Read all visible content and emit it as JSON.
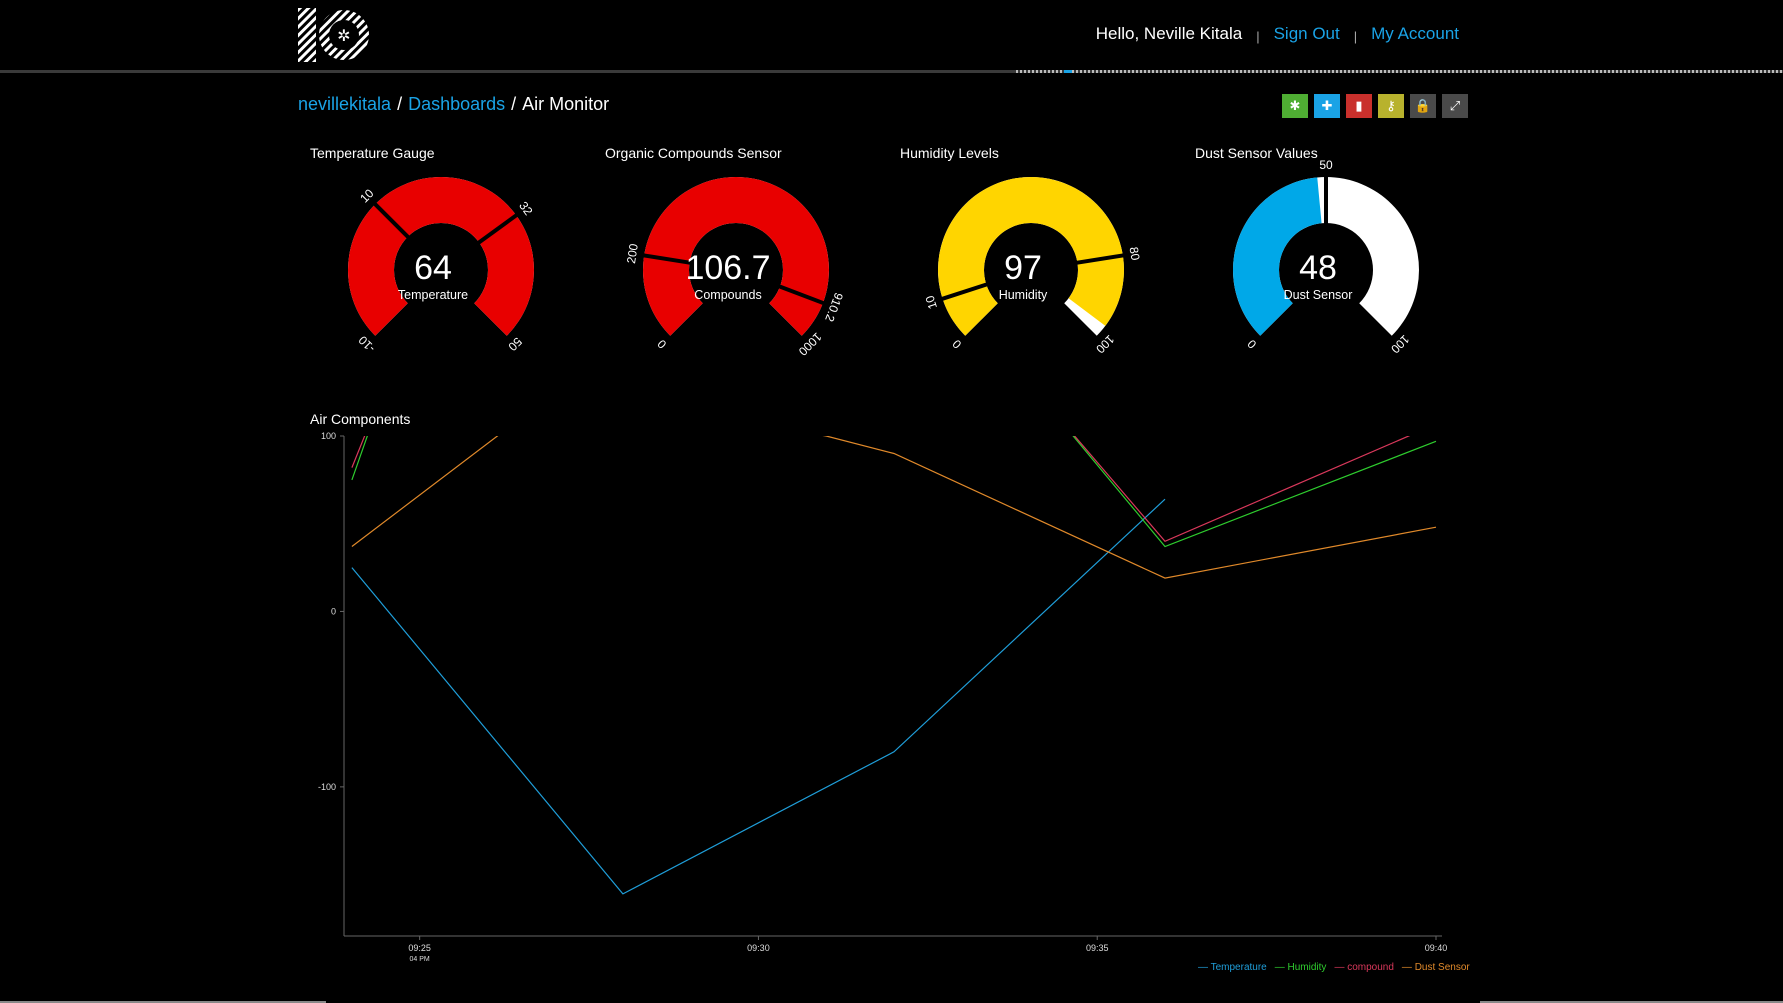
{
  "header": {
    "greeting": "Hello, Neville Kitala",
    "separator": "|",
    "sign_out": "Sign Out",
    "my_account": "My Account"
  },
  "breadcrumb": {
    "user": "nevillekitala",
    "slash": "/",
    "dashboards": "Dashboards",
    "current": "Air Monitor"
  },
  "toolbar": [
    {
      "name": "settings-button",
      "icon": "gear-icon",
      "glyph": "✱",
      "color": "#4fae33"
    },
    {
      "name": "add-block-button",
      "icon": "plus-icon",
      "glyph": "✚",
      "color": "#1aa3e6"
    },
    {
      "name": "delete-button",
      "icon": "trash-icon",
      "glyph": "▮",
      "color": "#c9302c"
    },
    {
      "name": "key-button",
      "icon": "key-icon",
      "glyph": "⚷",
      "color": "#b8b22d"
    },
    {
      "name": "lock-button",
      "icon": "lock-icon",
      "glyph": "🔒",
      "color": "#4a4a4a"
    },
    {
      "name": "fullscreen-button",
      "icon": "expand-icon",
      "glyph": "⤢",
      "color": "#4a4a4a"
    }
  ],
  "gauges": [
    {
      "title": "Temperature Gauge",
      "value": "64",
      "label": "Temperature",
      "min": -10,
      "max": 50,
      "current": 64,
      "min_label": "-10",
      "max_label": "50",
      "fill_color": "#e80000",
      "rest_color": "#ffffff",
      "thresholds": [
        {
          "value": 10,
          "label": "10"
        },
        {
          "value": 32,
          "label": "32"
        }
      ]
    },
    {
      "title": "Organic Compounds Sensor",
      "value": "106.7",
      "label": "Compounds",
      "min": 0,
      "max": 1000,
      "current": 1000,
      "min_label": "0",
      "max_label": "1000",
      "fill_color": "#e80000",
      "rest_color": "#ffffff",
      "thresholds": [
        {
          "value": 200,
          "label": "200"
        },
        {
          "value": 910.2,
          "label": "910.2"
        }
      ]
    },
    {
      "title": "Humidity Levels",
      "value": "97",
      "label": "Humidity",
      "min": 0,
      "max": 100,
      "current": 97,
      "min_label": "0",
      "max_label": "100",
      "fill_color": "#ffd500",
      "rest_color": "#ffffff",
      "thresholds": [
        {
          "value": 10,
          "label": "10"
        },
        {
          "value": 80,
          "label": "80"
        }
      ]
    },
    {
      "title": "Dust Sensor Values",
      "value": "48",
      "label": "Dust Sensor",
      "min": 0,
      "max": 100,
      "current": 48,
      "min_label": "0",
      "max_label": "100",
      "fill_color": "#00a8e8",
      "rest_color": "#ffffff",
      "thresholds": [
        {
          "value": 50,
          "label": "50"
        }
      ]
    }
  ],
  "chart_title": "Air Components",
  "chart_data": {
    "type": "line",
    "ylim": [
      -185,
      100
    ],
    "yticks": [
      {
        "value": 100,
        "label": "100"
      },
      {
        "value": 0,
        "label": "0"
      },
      {
        "value": -100,
        "label": "-100"
      }
    ],
    "xlim": [
      "09:23:53",
      "09:40"
    ],
    "xticks": [
      {
        "time": "09:25",
        "label": "09:25",
        "sublabel": "04 PM"
      },
      {
        "time": "09:30",
        "label": "09:30",
        "sublabel": ""
      },
      {
        "time": "09:35",
        "label": "09:35",
        "sublabel": ""
      },
      {
        "time": "09:40",
        "label": "09:40",
        "sublabel": ""
      }
    ],
    "series": [
      {
        "name": "Temperature",
        "color": "#1f9ed9",
        "points": [
          [
            "09:24",
            25
          ],
          [
            "09:28",
            -161
          ],
          [
            "09:32",
            -80
          ],
          [
            "09:36",
            64
          ]
        ]
      },
      {
        "name": "Humidity",
        "color": "#2ecc2e",
        "points": [
          [
            "09:24",
            75
          ],
          [
            "09:24:30",
            130
          ],
          [
            "09:34",
            130
          ],
          [
            "09:36",
            37
          ],
          [
            "09:40",
            97
          ]
        ]
      },
      {
        "name": "compound",
        "color": "#d9385b",
        "points": [
          [
            "09:24",
            82
          ],
          [
            "09:24:30",
            130
          ],
          [
            "09:34",
            130
          ],
          [
            "09:36",
            40
          ],
          [
            "09:40",
            106.7
          ]
        ]
      },
      {
        "name": "Dust Sensor",
        "color": "#e0892a",
        "points": [
          [
            "09:24",
            37
          ],
          [
            "09:27",
            125
          ],
          [
            "09:31",
            100
          ],
          [
            "09:32",
            90
          ],
          [
            "09:36",
            19
          ],
          [
            "09:40",
            48
          ]
        ]
      }
    ]
  }
}
